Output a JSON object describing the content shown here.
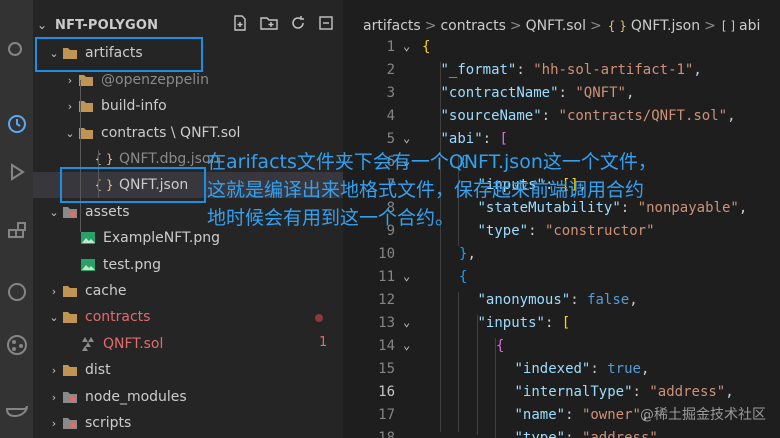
{
  "explorer": {
    "title": "NFT-POLYGON",
    "tree": [
      {
        "label": "artifacts",
        "chev": "⌄",
        "type": "folder"
      },
      {
        "label": "@openzeppelin",
        "chev": "›",
        "type": "folder"
      },
      {
        "label": "build-info",
        "chev": "›",
        "type": "folder"
      },
      {
        "label": "contracts \\ QNFT.sol",
        "chev": "⌄",
        "type": "folder"
      },
      {
        "label": "QNFT.dbg.json",
        "chev": "",
        "type": "json"
      },
      {
        "label": "QNFT.json",
        "chev": "",
        "type": "json"
      },
      {
        "label": "assets",
        "chev": "⌄",
        "type": "folder-special"
      },
      {
        "label": "ExampleNFT.png",
        "chev": "",
        "type": "image"
      },
      {
        "label": "test.png",
        "chev": "",
        "type": "image"
      },
      {
        "label": "cache",
        "chev": "›",
        "type": "folder"
      },
      {
        "label": "contracts",
        "chev": "⌄",
        "type": "folder"
      },
      {
        "label": "QNFT.sol",
        "chev": "",
        "type": "sol"
      },
      {
        "label": "dist",
        "chev": "›",
        "type": "folder"
      },
      {
        "label": "node_modules",
        "chev": "›",
        "type": "folder-special"
      },
      {
        "label": "scripts",
        "chev": "›",
        "type": "folder-special"
      }
    ],
    "error_count": "1",
    "colors": {
      "accent": "#1a8fe3",
      "error": "#e06c6c"
    }
  },
  "breadcrumbs": {
    "b0": "artifacts",
    "b1": "contracts",
    "b2": "QNFT.sol",
    "b3": "QNFT.json",
    "b4": "abi",
    "sep": ">"
  },
  "editor": {
    "lines": [
      {
        "n": "1",
        "tokens": [
          [
            "b1",
            "{"
          ]
        ]
      },
      {
        "n": "2",
        "tokens": [
          [
            "k",
            "\"_format\""
          ],
          [
            "p",
            ": "
          ],
          [
            "s",
            "\"hh-sol-artifact-1\""
          ],
          [
            "p",
            ","
          ]
        ]
      },
      {
        "n": "3",
        "tokens": [
          [
            "k",
            "\"contractName\""
          ],
          [
            "p",
            ": "
          ],
          [
            "s",
            "\"QNFT\""
          ],
          [
            "p",
            ","
          ]
        ]
      },
      {
        "n": "4",
        "tokens": [
          [
            "k",
            "\"sourceName\""
          ],
          [
            "p",
            ": "
          ],
          [
            "s",
            "\"contracts/QNFT.sol\""
          ],
          [
            "p",
            ","
          ]
        ]
      },
      {
        "n": "5",
        "tokens": [
          [
            "k",
            "\"abi\""
          ],
          [
            "p",
            ": "
          ],
          [
            "b2",
            "["
          ]
        ]
      },
      {
        "n": "6",
        "tokens": [
          [
            "b3",
            "{"
          ]
        ]
      },
      {
        "n": "7",
        "tokens": [
          [
            "k",
            "\"inputs\""
          ],
          [
            "p",
            ": "
          ],
          [
            "b1",
            "[]"
          ],
          [
            "p",
            ","
          ]
        ]
      },
      {
        "n": "8",
        "tokens": [
          [
            "k",
            "\"stateMutability\""
          ],
          [
            "p",
            ": "
          ],
          [
            "s",
            "\"nonpayable\""
          ],
          [
            "p",
            ","
          ]
        ]
      },
      {
        "n": "9",
        "tokens": [
          [
            "k",
            "\"type\""
          ],
          [
            "p",
            ": "
          ],
          [
            "s",
            "\"constructor\""
          ]
        ]
      },
      {
        "n": "10",
        "tokens": [
          [
            "b3",
            "}"
          ],
          [
            "p",
            ","
          ]
        ]
      },
      {
        "n": "11",
        "tokens": [
          [
            "b3",
            "{"
          ]
        ]
      },
      {
        "n": "12",
        "tokens": [
          [
            "k",
            "\"anonymous\""
          ],
          [
            "p",
            ": "
          ],
          [
            "kw",
            "false"
          ],
          [
            "p",
            ","
          ]
        ]
      },
      {
        "n": "13",
        "tokens": [
          [
            "k",
            "\"inputs\""
          ],
          [
            "p",
            ": "
          ],
          [
            "b1",
            "["
          ]
        ]
      },
      {
        "n": "14",
        "tokens": [
          [
            "b2",
            "{"
          ]
        ]
      },
      {
        "n": "15",
        "tokens": [
          [
            "k",
            "\"indexed\""
          ],
          [
            "p",
            ": "
          ],
          [
            "kw",
            "true"
          ],
          [
            "p",
            ","
          ]
        ]
      },
      {
        "n": "16",
        "tokens": [
          [
            "k",
            "\"internalType\""
          ],
          [
            "p",
            ": "
          ],
          [
            "s",
            "\"address\""
          ],
          [
            "p",
            ","
          ]
        ]
      },
      {
        "n": "17",
        "tokens": [
          [
            "k",
            "\"name\""
          ],
          [
            "p",
            ": "
          ],
          [
            "s",
            "\"owner\""
          ],
          [
            "p",
            ","
          ]
        ]
      },
      {
        "n": "18",
        "tokens": [
          [
            "k",
            "\"type\""
          ],
          [
            "p",
            ": "
          ],
          [
            "s",
            "\"address\""
          ]
        ]
      }
    ]
  },
  "annotation": {
    "line1": "在arifacts文件夹下会有一个QNFT.json这一个文件，",
    "line2": "这就是编译出来地格式文件，保存起来前端调用合约",
    "line3": "地时候会有用到这一个合约。"
  },
  "watermark": "@稀土掘金技术社区"
}
